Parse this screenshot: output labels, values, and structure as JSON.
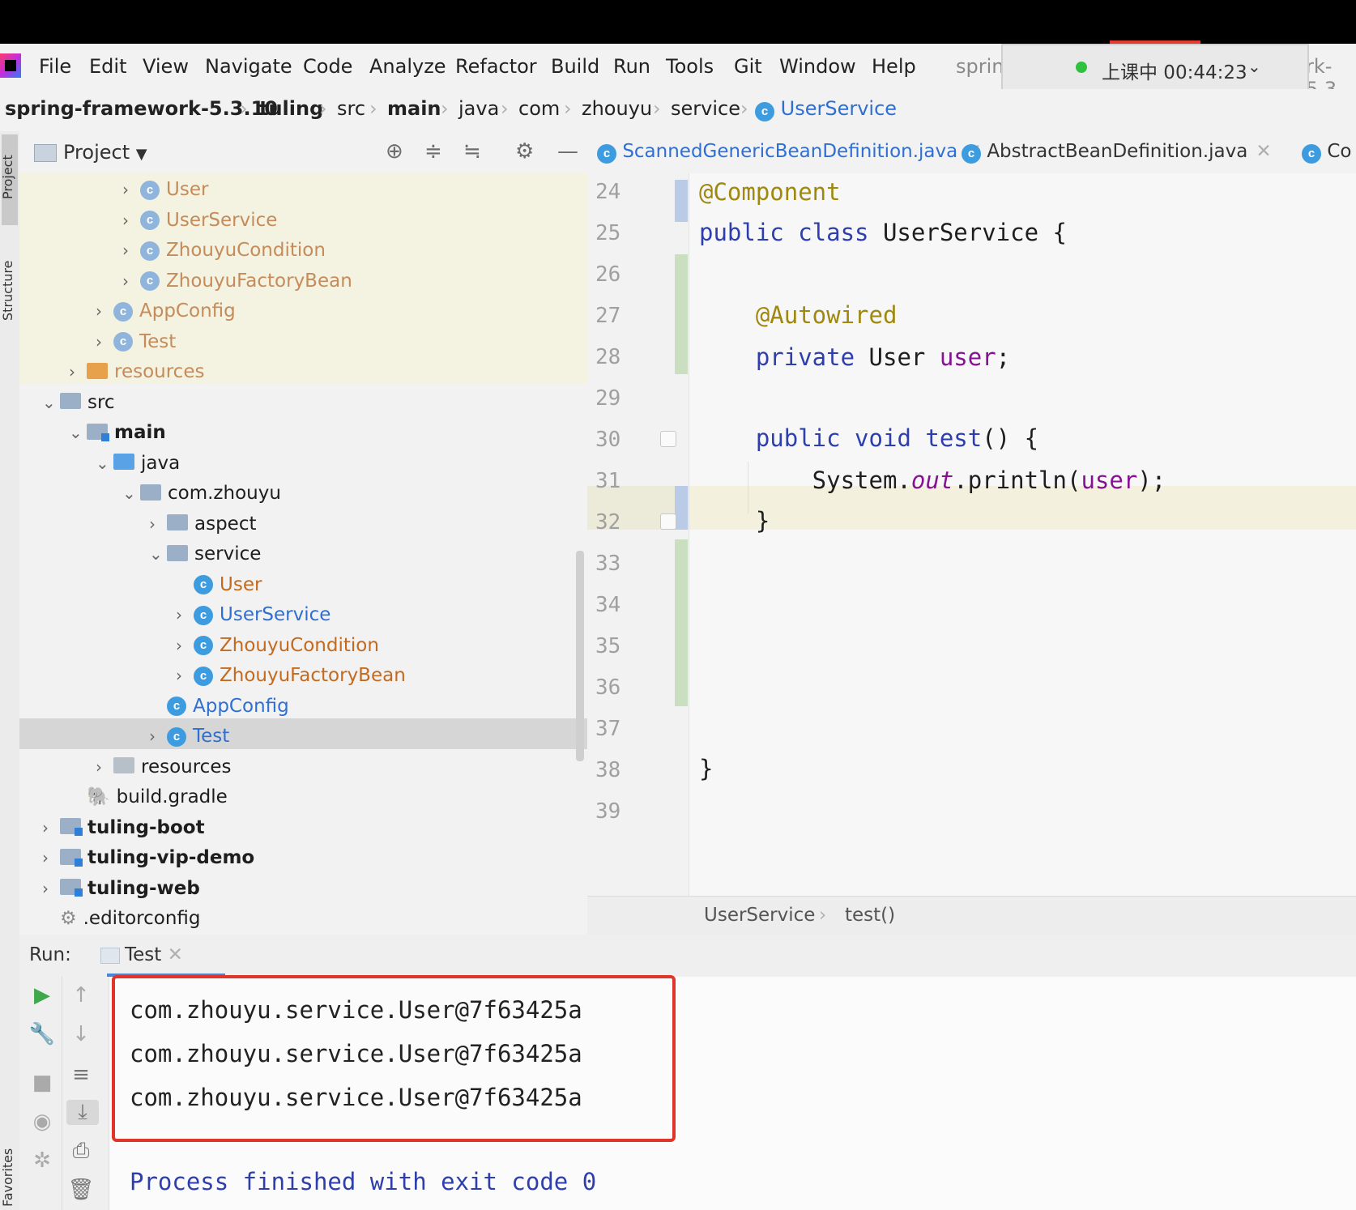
{
  "menu": {
    "items": [
      "File",
      "Edit",
      "View",
      "Navigate",
      "Code",
      "Analyze",
      "Refactor",
      "Build",
      "Run",
      "Tools",
      "Git",
      "Window",
      "Help"
    ],
    "truncated_left": "sprin",
    "truncated_right": "rk-5.3"
  },
  "timer": {
    "label": "上课中 00:44:23",
    "status_color": "#2ec240"
  },
  "breadcrumb": {
    "items": [
      "spring-framework-5.3.10",
      "tuling",
      "src",
      "main",
      "java",
      "com",
      "zhouyu",
      "service",
      "UserService"
    ]
  },
  "project_panel": {
    "title": "Project",
    "tree": [
      {
        "label": "User",
        "indent": 4,
        "arrow": "right",
        "icon": "class",
        "color": "dimorange"
      },
      {
        "label": "UserService",
        "indent": 4,
        "arrow": "right",
        "icon": "class",
        "color": "dimorange"
      },
      {
        "label": "ZhouyuCondition",
        "indent": 4,
        "arrow": "right",
        "icon": "class",
        "color": "dimorange"
      },
      {
        "label": "ZhouyuFactoryBean",
        "indent": 4,
        "arrow": "right",
        "icon": "class",
        "color": "dimorange"
      },
      {
        "label": "AppConfig",
        "indent": 3,
        "arrow": "right",
        "icon": "class",
        "color": "dimorange"
      },
      {
        "label": "Test",
        "indent": 3,
        "arrow": "right",
        "icon": "class-run",
        "color": "dimorange"
      },
      {
        "label": "resources",
        "indent": 2,
        "arrow": "right",
        "icon": "folder-orange",
        "color": "dimorange"
      },
      {
        "label": "src",
        "indent": 1,
        "arrow": "down",
        "icon": "folder",
        "color": "normal"
      },
      {
        "label": "main",
        "indent": 2,
        "arrow": "down",
        "icon": "folder-mod",
        "color": "bold"
      },
      {
        "label": "java",
        "indent": 3,
        "arrow": "down",
        "icon": "folder-blue",
        "color": "normal"
      },
      {
        "label": "com.zhouyu",
        "indent": 4,
        "arrow": "down",
        "icon": "folder",
        "color": "normal"
      },
      {
        "label": "aspect",
        "indent": 5,
        "arrow": "right",
        "icon": "folder",
        "color": "normal"
      },
      {
        "label": "service",
        "indent": 5,
        "arrow": "down",
        "icon": "folder",
        "color": "normal"
      },
      {
        "label": "User",
        "indent": 6,
        "arrow": "none",
        "icon": "class",
        "color": "orange"
      },
      {
        "label": "UserService",
        "indent": 6,
        "arrow": "right",
        "icon": "class",
        "color": "blue"
      },
      {
        "label": "ZhouyuCondition",
        "indent": 6,
        "arrow": "right",
        "icon": "class",
        "color": "orange"
      },
      {
        "label": "ZhouyuFactoryBean",
        "indent": 6,
        "arrow": "right",
        "icon": "class",
        "color": "orange"
      },
      {
        "label": "AppConfig",
        "indent": 5,
        "arrow": "none",
        "icon": "class",
        "color": "blue"
      },
      {
        "label": "Test",
        "indent": 5,
        "arrow": "right",
        "icon": "class-run",
        "color": "blue"
      },
      {
        "label": "resources",
        "indent": 3,
        "arrow": "right",
        "icon": "folder-res",
        "color": "normal"
      },
      {
        "label": "build.gradle",
        "indent": 2,
        "arrow": "none",
        "icon": "gradle",
        "color": "normal"
      },
      {
        "label": "tuling-boot",
        "indent": 1,
        "arrow": "right",
        "icon": "folder-mod",
        "color": "bold"
      },
      {
        "label": "tuling-vip-demo",
        "indent": 1,
        "arrow": "right",
        "icon": "folder-mod",
        "color": "bold"
      },
      {
        "label": "tuling-web",
        "indent": 1,
        "arrow": "right",
        "icon": "folder-mod",
        "color": "bold"
      },
      {
        "label": ".editorconfig",
        "indent": 1,
        "arrow": "none",
        "icon": "gear",
        "color": "normal"
      }
    ]
  },
  "side_strip": {
    "project": "Project",
    "structure": "Structure",
    "favorites": "Favorites"
  },
  "editor_tabs": [
    {
      "label": "ScannedGenericBeanDefinition.java",
      "active": true
    },
    {
      "label": "AbstractBeanDefinition.java",
      "active": false
    },
    {
      "label": "Co",
      "active": false
    }
  ],
  "editor": {
    "line_numbers": [
      "24",
      "25",
      "26",
      "27",
      "28",
      "29",
      "30",
      "31",
      "32",
      "33",
      "34",
      "35",
      "36",
      "37",
      "38",
      "39"
    ],
    "current_line": "31",
    "breadcrumb": [
      "UserService",
      "test()"
    ]
  },
  "run_panel": {
    "label": "Run:",
    "tab": "Test",
    "output": [
      "com.zhouyu.service.User@7f63425a",
      "com.zhouyu.service.User@7f63425a",
      "com.zhouyu.service.User@7f63425a"
    ],
    "exit_message": "Process finished with exit code 0"
  },
  "colors": {
    "highlight_box": "#e0352b",
    "keyword": "#2e3eac",
    "annotation": "#9e880d",
    "field": "#871094"
  }
}
